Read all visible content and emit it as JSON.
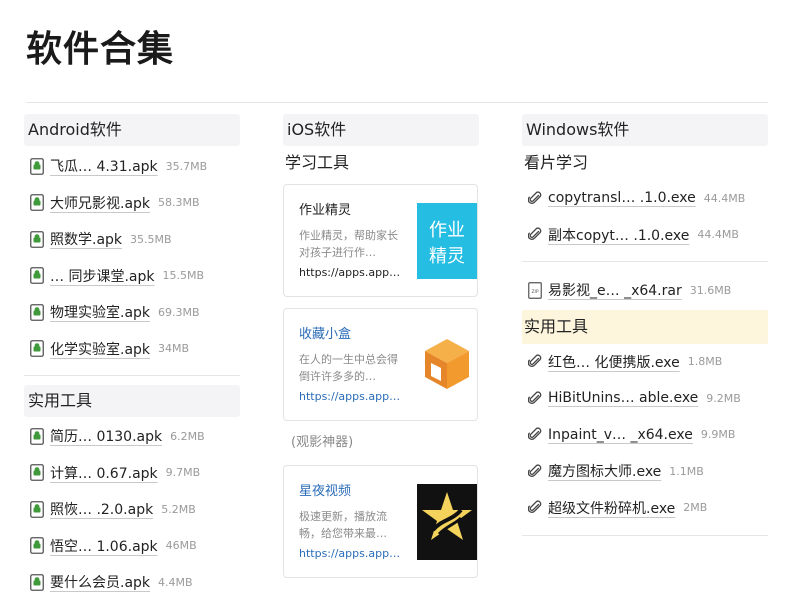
{
  "page": {
    "title": "软件合集"
  },
  "android": {
    "heading": "Android软件",
    "files": [
      {
        "name": "飞瓜…  4.31.apk",
        "size": "35.7MB"
      },
      {
        "name": "大师兄影视.apk",
        "size": "58.3MB"
      },
      {
        "name": "照数学.apk",
        "size": "35.5MB"
      },
      {
        "name": "…  同步课堂.apk",
        "size": "15.5MB"
      },
      {
        "name": "物理实验室.apk",
        "size": "69.3MB"
      },
      {
        "name": "化学实验室.apk",
        "size": "34MB"
      }
    ],
    "tools_heading": "实用工具",
    "tools": [
      {
        "name": "简历…  0130.apk",
        "size": "6.2MB"
      },
      {
        "name": "计算…  0.67.apk",
        "size": "9.7MB"
      },
      {
        "name": "照恢…    .2.0.apk",
        "size": "5.2MB"
      },
      {
        "name": "悟空…  1.06.apk",
        "size": "46MB"
      },
      {
        "name": "要什么会员.apk",
        "size": "4.4MB"
      }
    ]
  },
  "ios": {
    "heading": "iOS软件",
    "study_heading": "学习工具",
    "cards": [
      {
        "title": "作业精灵",
        "desc": "作业精灵，帮助家长对孩子进行作…",
        "link": "https://apps.app…",
        "thumb": "zuoye-jingling-app-icon"
      },
      {
        "title": "收藏小盒",
        "desc": "在人的一生中总会得倒许许多多的…",
        "link": "https://apps.app…",
        "thumb": "shoucang-xiaohe-app-icon"
      },
      {
        "title": "星夜视频",
        "desc": "极速更新，播放流畅，给您带来最…",
        "link": "https://apps.app…",
        "thumb": "xingye-shipin-app-icon"
      }
    ],
    "caption": "(观影神器)",
    "thumb_text": {
      "zuoye_line1": "作业",
      "zuoye_line2": "精灵"
    }
  },
  "windows": {
    "heading": "Windows软件",
    "study_heading": "看片学习",
    "study_files": [
      {
        "name": "copytransl… .1.0.exe",
        "size": "44.4MB",
        "icon": "paperclip-icon"
      },
      {
        "name": "副本copyt…  .1.0.exe",
        "size": "44.4MB",
        "icon": "paperclip-icon"
      }
    ],
    "archive_files": [
      {
        "name": "易影视_e…  _x64.rar",
        "size": "31.6MB",
        "icon": "zip-file-icon"
      }
    ],
    "tools_heading": "实用工具",
    "tools": [
      {
        "name": "红色…    化便携版.exe",
        "size": "1.8MB",
        "icon": "paperclip-icon"
      },
      {
        "name": "HiBitUnins…  able.exe",
        "size": "9.2MB",
        "icon": "paperclip-icon"
      },
      {
        "name": "Inpaint_v…  _x64.exe",
        "size": "9.9MB",
        "icon": "paperclip-icon"
      },
      {
        "name": "魔方图标大师.exe",
        "size": "1.1MB",
        "icon": "paperclip-icon"
      },
      {
        "name": "超级文件粉碎机.exe",
        "size": "2MB",
        "icon": "paperclip-icon"
      }
    ],
    "zip_label": "ZIP"
  },
  "colors": {
    "android_green": "#3f9a3a",
    "link_blue": "#2a6cb8",
    "highlight_yellow": "#fdf5dc",
    "section_gray": "#f4f4f6"
  }
}
